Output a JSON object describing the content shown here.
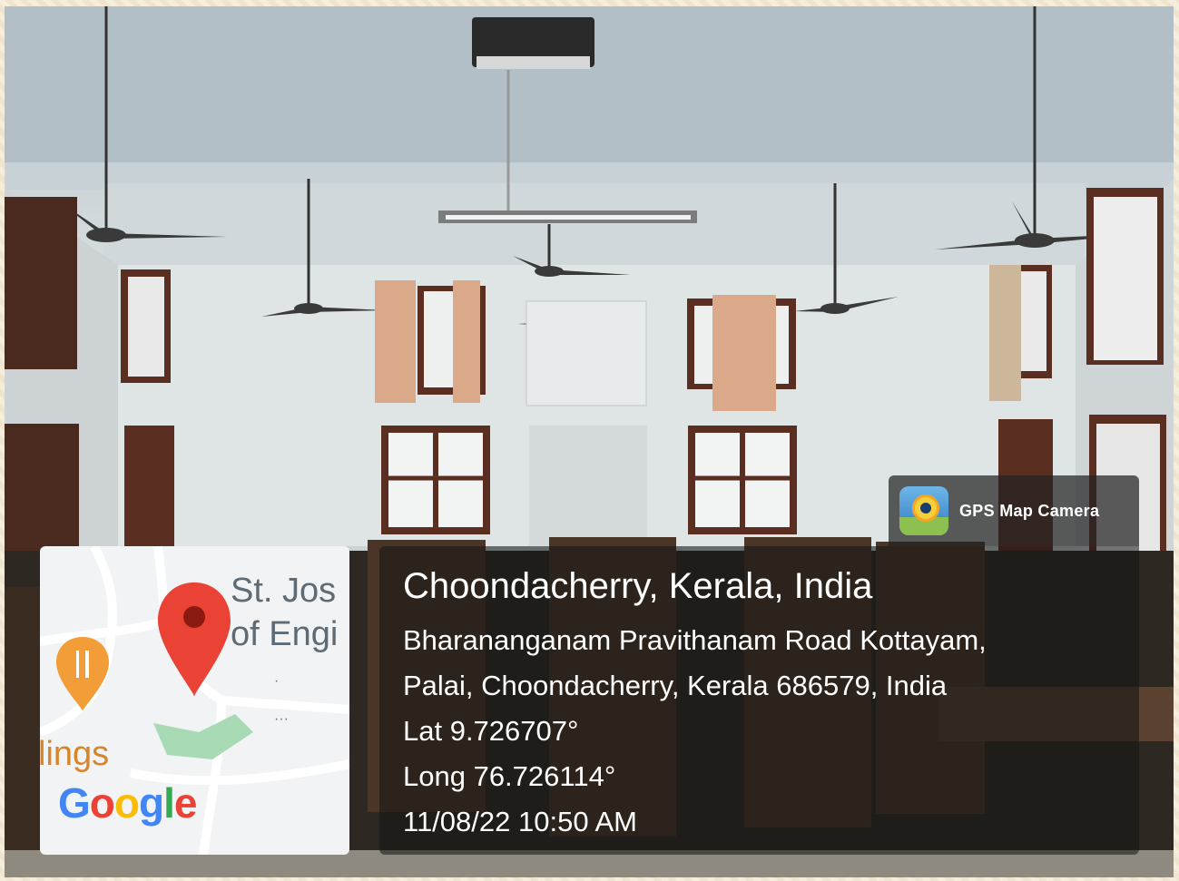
{
  "badge": {
    "label": "GPS Map Camera"
  },
  "location": {
    "title": "Choondacherry, Kerala, India",
    "address_line1": "Bharananganam Pravithanam Road Kottayam,",
    "address_line2": "Palai, Choondacherry, Kerala 686579, India",
    "latitude": "Lat 9.726707°",
    "longitude": "Long 76.726114°",
    "timestamp": "11/08/22 10:50 AM"
  },
  "map": {
    "place_label_line1": "St. Jos",
    "place_label_line2": "of Engi",
    "partial_label": "lings",
    "dots": "·",
    "dots2": "···",
    "brand": [
      "G",
      "o",
      "o",
      "g",
      "l",
      "e"
    ],
    "icons": [
      "map-pin-icon",
      "restaurant-icon"
    ],
    "colors": {
      "pin": "#ea4335",
      "restaurant": "#f29d38",
      "park": "#a8dab5"
    }
  },
  "photo": {
    "subject": "classroom-interior"
  }
}
